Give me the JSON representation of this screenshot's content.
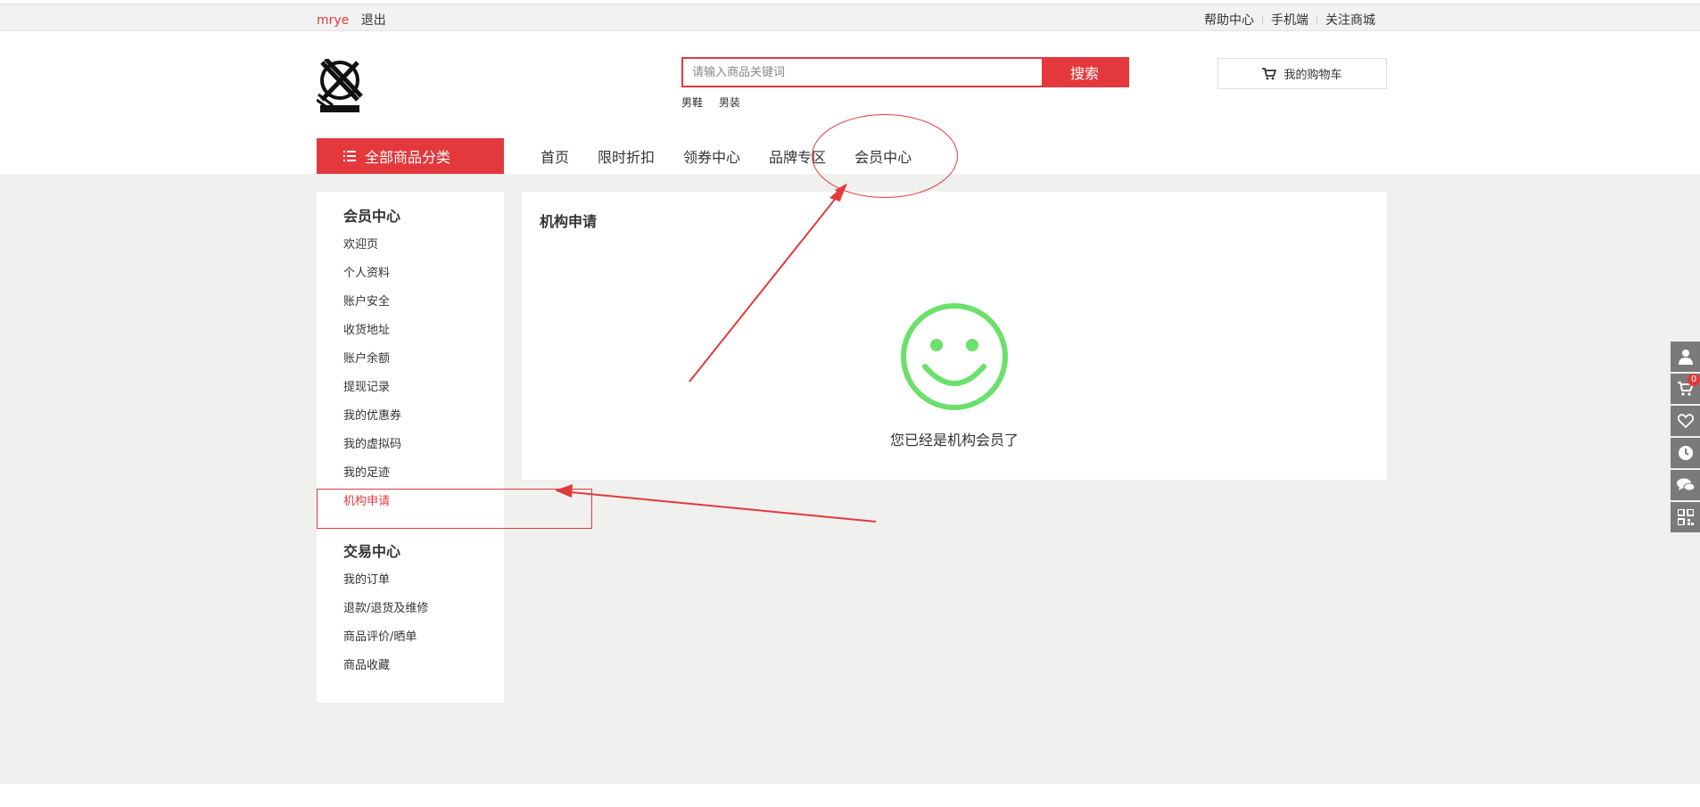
{
  "topbar": {
    "username": "mrye",
    "logout": "退出",
    "links": [
      "帮助中心",
      "手机端",
      "关注商城"
    ]
  },
  "header": {
    "logo_icon": "brand-logo-icon",
    "search": {
      "placeholder": "请输入商品关键词",
      "button": "搜索",
      "hot_words": [
        "男鞋",
        "男装"
      ]
    },
    "cart": {
      "label": "我的购物车",
      "icon": "cart-icon"
    }
  },
  "nav": {
    "category_button": "全部商品分类",
    "items": [
      "首页",
      "限时折扣",
      "领券中心",
      "品牌专区",
      "会员中心"
    ]
  },
  "sidebar": {
    "groups": [
      {
        "title": "会员中心",
        "items": [
          "欢迎页",
          "个人资料",
          "账户安全",
          "收货地址",
          "账户余额",
          "提现记录",
          "我的优惠券",
          "我的虚拟码",
          "我的足迹",
          "机构申请"
        ]
      },
      {
        "title": "交易中心",
        "items": [
          "我的订单",
          "退款/退货及维修",
          "商品评价/晒单",
          "商品收藏"
        ]
      }
    ],
    "active_item": "机构申请"
  },
  "content": {
    "title": "机构申请",
    "status_icon": "smiley-face-icon",
    "message": "您已经是机构会员了"
  },
  "side_tools": {
    "icons": [
      "user-icon",
      "cart-icon",
      "heart-icon",
      "clock-icon",
      "chat-icon",
      "qrcode-icon"
    ],
    "cart_count": "0"
  },
  "colors": {
    "brand_red": "#e4393c",
    "smile_green": "#6be06b",
    "page_bg": "#f0f0ee"
  }
}
